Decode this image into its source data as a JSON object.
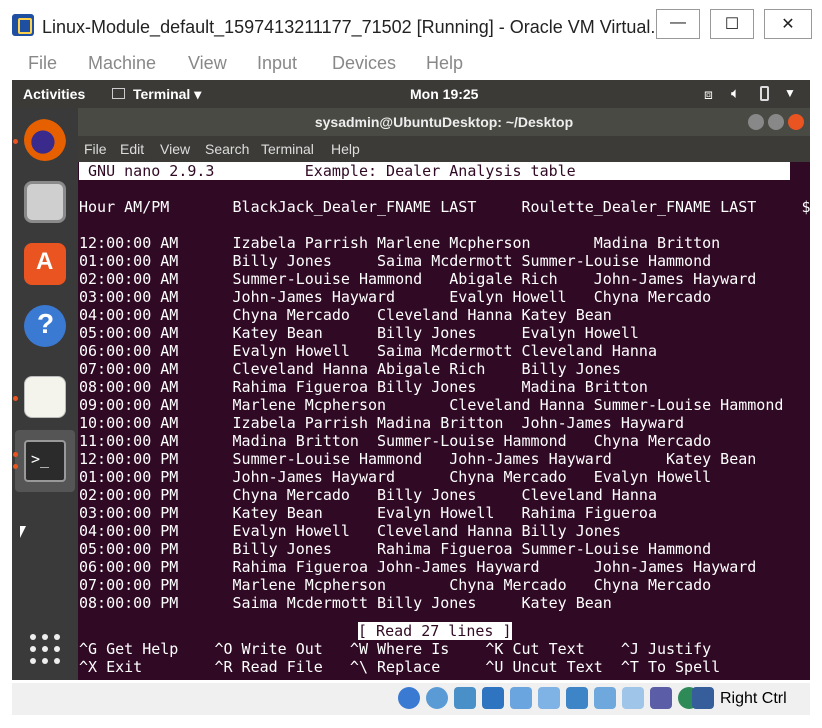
{
  "host": {
    "title": "Linux-Module_default_1597413211177_71502 [Running] - Oracle VM Virtual...",
    "menu": [
      "File",
      "Machine",
      "View",
      "Input",
      "Devices",
      "Help"
    ],
    "host_key": "Right Ctrl"
  },
  "topbar": {
    "activities": "Activities",
    "app": "Terminal ▾",
    "clock": "Mon 19:25"
  },
  "terminal": {
    "title": "sysadmin@UbuntuDesktop: ~/Desktop",
    "menu": [
      "File",
      "Edit",
      "View",
      "Search",
      "Terminal",
      "Help"
    ]
  },
  "nano": {
    "header": " GNU nano 2.9.3          Example: Dealer Analysis table",
    "lines": [
      "Hour AM/PM       BlackJack_Dealer_FNAME LAST     Roulette_Dealer_FNAME LAST     $",
      "",
      "12:00:00 AM      Izabela Parrish Marlene Mcpherson       Madina Britton",
      "01:00:00 AM      Billy Jones     Saima Mcdermott Summer-Louise Hammond",
      "02:00:00 AM      Summer-Louise Hammond   Abigale Rich    John-James Hayward",
      "03:00:00 AM      John-James Hayward      Evalyn Howell   Chyna Mercado",
      "04:00:00 AM      Chyna Mercado   Cleveland Hanna Katey Bean",
      "05:00:00 AM      Katey Bean      Billy Jones     Evalyn Howell",
      "06:00:00 AM      Evalyn Howell   Saima Mcdermott Cleveland Hanna",
      "07:00:00 AM      Cleveland Hanna Abigale Rich    Billy Jones",
      "08:00:00 AM      Rahima Figueroa Billy Jones     Madina Britton",
      "09:00:00 AM      Marlene Mcpherson       Cleveland Hanna Summer-Louise Hammond",
      "10:00:00 AM      Izabela Parrish Madina Britton  John-James Hayward",
      "11:00:00 AM      Madina Britton  Summer-Louise Hammond   Chyna Mercado",
      "12:00:00 PM      Summer-Louise Hammond   John-James Hayward      Katey Bean",
      "01:00:00 PM      John-James Hayward      Chyna Mercado   Evalyn Howell",
      "02:00:00 PM      Chyna Mercado   Billy Jones     Cleveland Hanna",
      "03:00:00 PM      Katey Bean      Evalyn Howell   Rahima Figueroa",
      "04:00:00 PM      Evalyn Howell   Cleveland Hanna Billy Jones",
      "05:00:00 PM      Billy Jones     Rahima Figueroa Summer-Louise Hammond",
      "06:00:00 PM      Rahima Figueroa John-James Hayward      John-James Hayward",
      "07:00:00 PM      Marlene Mcpherson       Chyna Mercado   Chyna Mercado",
      "08:00:00 PM      Saima Mcdermott Billy Jones     Katey Bean"
    ],
    "status": "[ Read 27 lines ]",
    "shortcuts_row1": "^G Get Help    ^O Write Out   ^W Where Is    ^K Cut Text    ^J Justify",
    "shortcuts_row2": "^X Exit        ^R Read File   ^\\ Replace     ^U Uncut Text  ^T To Spell"
  },
  "colors": {
    "terminal_bg": "#300a24",
    "ubuntu_orange": "#e95420"
  }
}
